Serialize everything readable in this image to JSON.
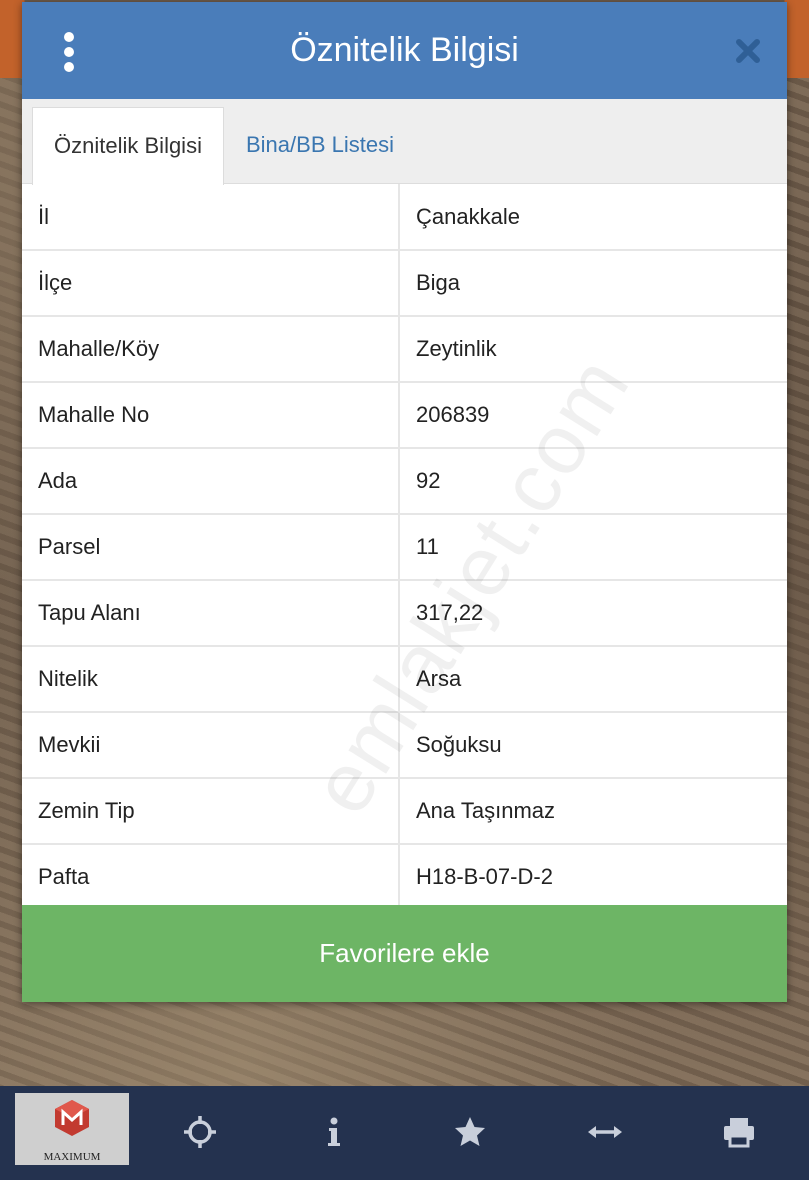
{
  "dialog": {
    "title": "Öznitelik Bilgisi",
    "colors": {
      "header": "#4a7dba",
      "favorite_button": "#6db565",
      "toolbar": "#24324f"
    }
  },
  "tabs": [
    {
      "label": "Öznitelik Bilgisi",
      "active": true
    },
    {
      "label": "Bina/BB Listesi",
      "active": false
    }
  ],
  "attributes": [
    {
      "key": "İl",
      "value": "Çanakkale"
    },
    {
      "key": "İlçe",
      "value": "Biga"
    },
    {
      "key": "Mahalle/Köy",
      "value": "Zeytinlik"
    },
    {
      "key": "Mahalle No",
      "value": "206839"
    },
    {
      "key": "Ada",
      "value": "92"
    },
    {
      "key": "Parsel",
      "value": "11"
    },
    {
      "key": "Tapu Alanı",
      "value": "317,22"
    },
    {
      "key": "Nitelik",
      "value": "Arsa"
    },
    {
      "key": "Mevkii",
      "value": "Soğuksu"
    },
    {
      "key": "Zemin Tip",
      "value": "Ana Taşınmaz"
    },
    {
      "key": "Pafta",
      "value": "H18-B-07-D-2"
    }
  ],
  "favorite_button_label": "Favorilere ekle",
  "watermark": "emlakjet.com",
  "toolbar": {
    "logo_text": "MAXIMUM",
    "icons": [
      "crosshair-icon",
      "info-icon",
      "star-icon",
      "measure-icon",
      "print-icon"
    ]
  }
}
